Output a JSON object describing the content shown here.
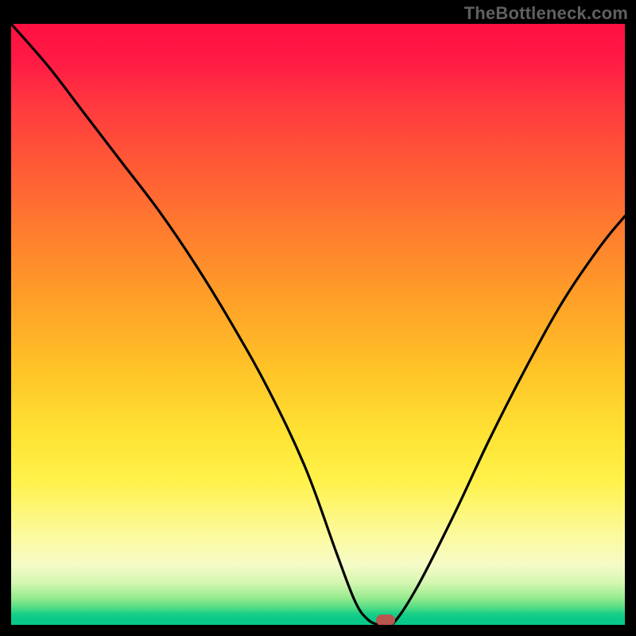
{
  "watermark": "TheBottleneck.com",
  "chart_data": {
    "type": "line",
    "title": "",
    "xlabel": "",
    "ylabel": "",
    "xlim": [
      0,
      100
    ],
    "ylim": [
      0,
      100
    ],
    "grid": false,
    "legend": false,
    "series": [
      {
        "name": "bottleneck-curve",
        "x": [
          0,
          6,
          12,
          18,
          24,
          30,
          36,
          42,
          48,
          53,
          56,
          58,
          60,
          62,
          66,
          72,
          78,
          84,
          90,
          96,
          100
        ],
        "y": [
          100,
          93,
          85,
          77,
          69,
          60,
          50,
          39,
          26,
          12,
          4,
          1,
          0,
          0,
          6,
          18,
          31,
          43,
          54,
          63,
          68
        ]
      }
    ],
    "marker": {
      "x": 61,
      "y": 0,
      "color": "#b7564f"
    },
    "background_gradient": {
      "stops": [
        {
          "pos": 0,
          "color": "#ff1040"
        },
        {
          "pos": 0.35,
          "color": "#ff7e2e"
        },
        {
          "pos": 0.68,
          "color": "#ffe233"
        },
        {
          "pos": 0.9,
          "color": "#f6fbc7"
        },
        {
          "pos": 0.97,
          "color": "#4fdc85"
        },
        {
          "pos": 1.0,
          "color": "#07c88a"
        }
      ]
    }
  }
}
